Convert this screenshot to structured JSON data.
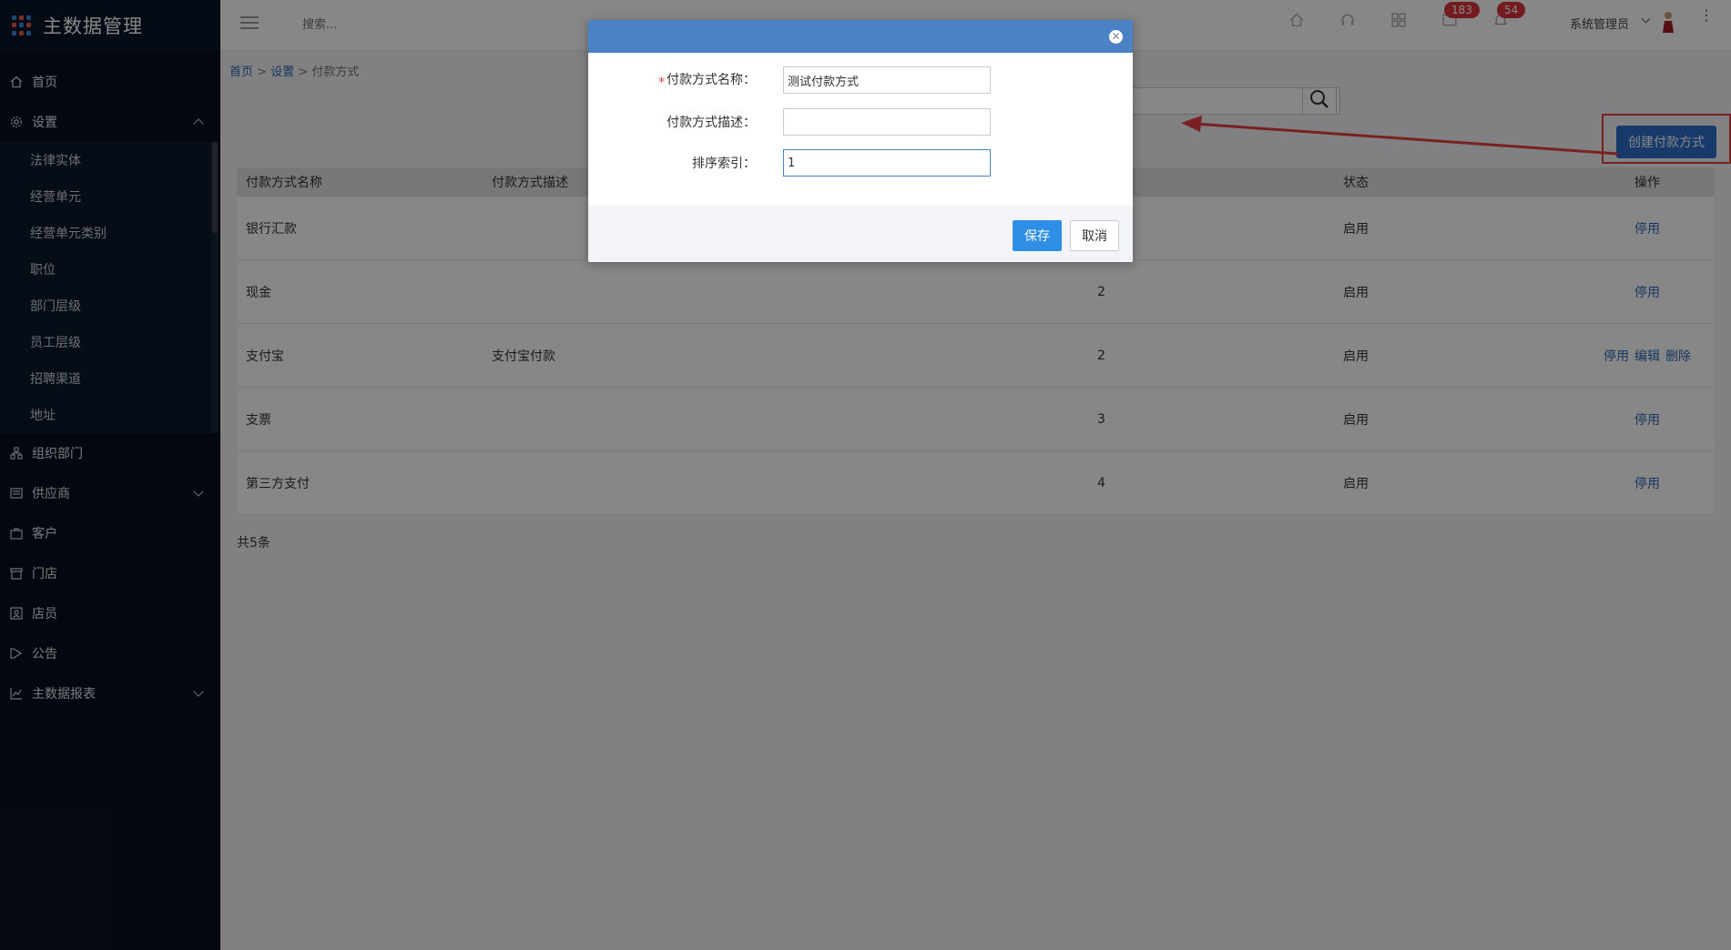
{
  "app": {
    "title": "主数据管理"
  },
  "sidebar": {
    "items": [
      {
        "label": "首页",
        "icon": "home-icon"
      },
      {
        "label": "设置",
        "icon": "gear-icon",
        "expanded": true
      },
      {
        "label": "组织部门",
        "icon": "org-icon"
      },
      {
        "label": "供应商",
        "icon": "supplier-icon"
      },
      {
        "label": "客户",
        "icon": "customer-icon"
      },
      {
        "label": "门店",
        "icon": "store-icon"
      },
      {
        "label": "店员",
        "icon": "clerk-icon"
      },
      {
        "label": "公告",
        "icon": "announcement-icon"
      },
      {
        "label": "主数据报表",
        "icon": "chart-icon"
      }
    ],
    "settings_sub": [
      "法律实体",
      "经营单元",
      "经营单元类别",
      "职位",
      "部门层级",
      "员工层级",
      "招聘渠道",
      "地址"
    ]
  },
  "topbar": {
    "search_placeholder": "搜索...",
    "badge_messages": "183",
    "badge_notifications": "54",
    "user_name": "系统管理员"
  },
  "breadcrumb": {
    "home": "首页",
    "settings": "设置",
    "current": "付款方式"
  },
  "toolbar": {
    "create_label": "创建付款方式"
  },
  "table": {
    "headers": [
      "付款方式名称",
      "付款方式描述",
      "",
      "状态",
      "操作"
    ],
    "rows": [
      {
        "name": "银行汇款",
        "desc": "",
        "index": "",
        "status": "启用",
        "ops": [
          "停用"
        ]
      },
      {
        "name": "现金",
        "desc": "",
        "index": "2",
        "status": "启用",
        "ops": [
          "停用"
        ]
      },
      {
        "name": "支付宝",
        "desc": "支付宝付款",
        "index": "2",
        "status": "启用",
        "ops": [
          "停用",
          "编辑",
          "删除"
        ]
      },
      {
        "name": "支票",
        "desc": "",
        "index": "3",
        "status": "启用",
        "ops": [
          "停用"
        ]
      },
      {
        "name": "第三方支付",
        "desc": "",
        "index": "4",
        "status": "启用",
        "ops": [
          "停用"
        ]
      }
    ],
    "total": "共5条"
  },
  "modal": {
    "name_label": "付款方式名称：",
    "name_value": "测试付款方式",
    "desc_label": "付款方式描述：",
    "desc_value": "",
    "index_label": "排序索引：",
    "index_value": "1",
    "save_label": "保存",
    "cancel_label": "取消",
    "required_mark": "*"
  },
  "colors": {
    "sidebar_bg": "#07101f",
    "primary": "#2f6fc9",
    "modal_header": "#4a82c5",
    "badge": "#d9343a",
    "annotation_red": "#e53e3e"
  }
}
